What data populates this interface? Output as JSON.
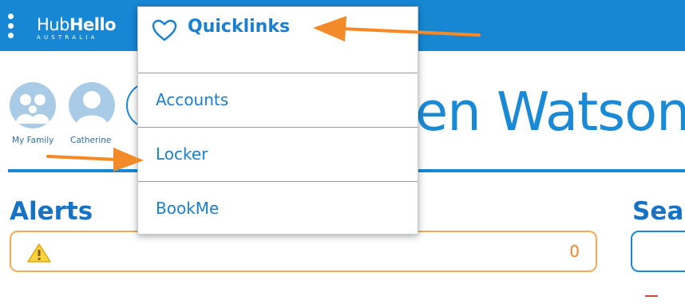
{
  "header": {
    "menu_icon": "kebab-menu-icon",
    "logo_primary": "Hub",
    "logo_bold": "Hello",
    "logo_sub": "AUSTRALIA"
  },
  "profile": {
    "avatars": [
      {
        "label": "My Family",
        "icon": "family-avatar-icon"
      },
      {
        "label": "Catherine",
        "icon": "person-avatar-icon"
      }
    ],
    "name_partial": "en Watson"
  },
  "alerts": {
    "title": "Alerts",
    "icon": "warning-icon",
    "count": "0",
    "border_color": "#f5ab52"
  },
  "search": {
    "title_partial": "Sear"
  },
  "quicklinks_menu": {
    "header_label": "Quicklinks",
    "header_icon": "heart-icon",
    "items": [
      {
        "label": "Accounts"
      },
      {
        "label": "Locker"
      },
      {
        "label": "BookMe"
      }
    ]
  },
  "colors": {
    "brand_blue": "#1787d4",
    "link_blue": "#1a7fd0",
    "annotation_arrow": "#f28a2a"
  }
}
